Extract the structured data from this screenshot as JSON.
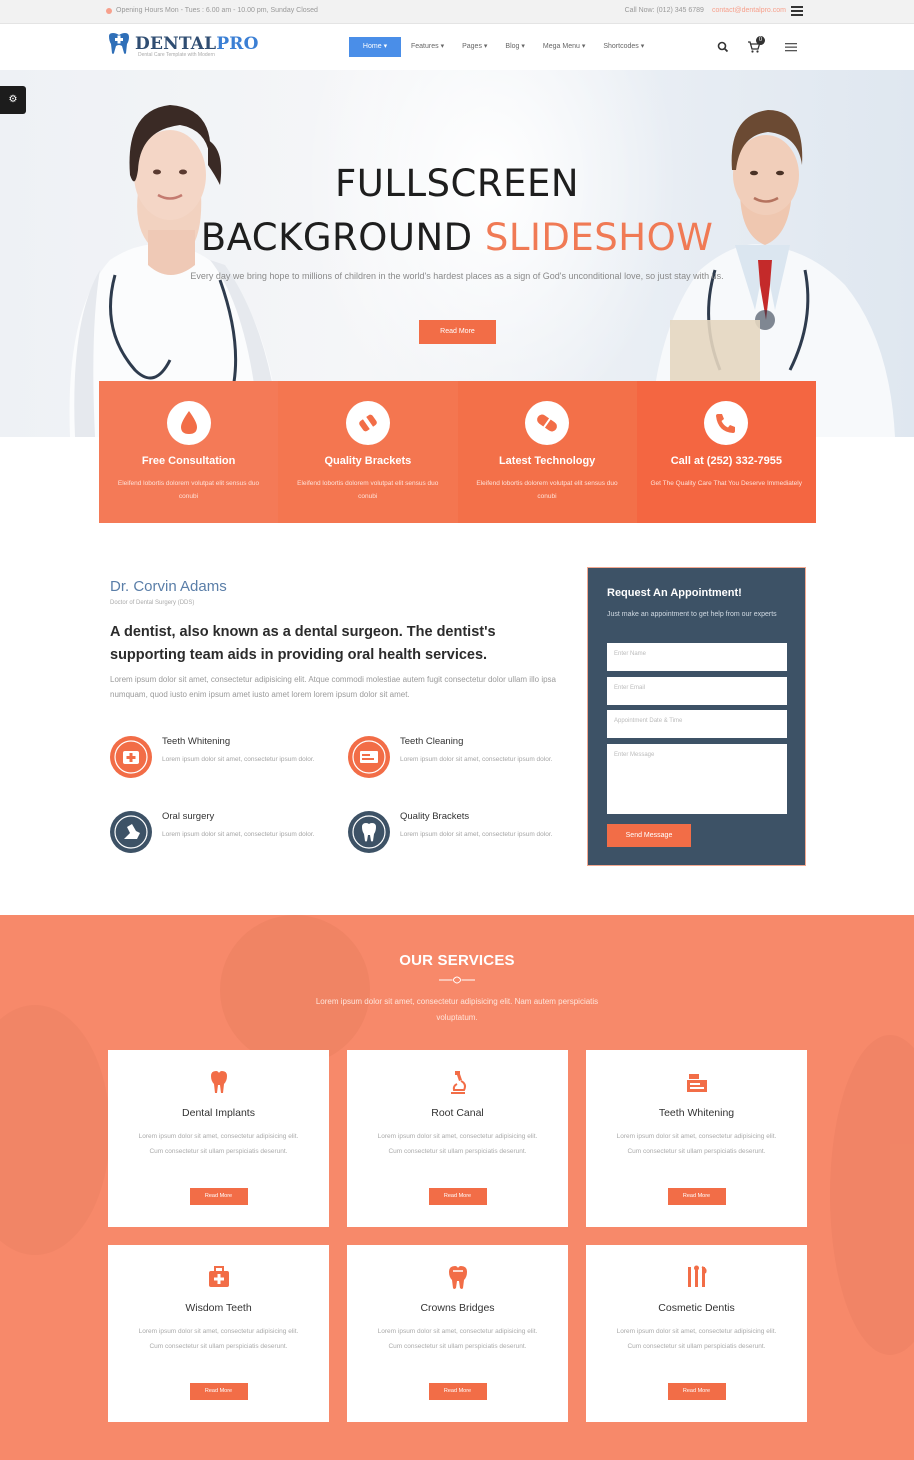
{
  "topbar": {
    "hours": "Opening Hours Mon - Tues : 6.00 am - 10.00 pm, Sunday Closed",
    "phone": "Call Now: (012) 345 6789",
    "email": "contact@dentalpro.com"
  },
  "header": {
    "logo_main": "DENTAL",
    "logo_accent": "PRO",
    "logo_tagline": "Dental Care Template with Modern",
    "nav": [
      "Home",
      "Features",
      "Pages",
      "Blog",
      "Mega Menu",
      "Shortcodes"
    ],
    "cart_count": "0"
  },
  "hero": {
    "title_line1": "FULLSCREEN",
    "title_line2": "BACKGROUND ",
    "title_accent": "SLIDESHOW",
    "text": "Every day we bring hope to millions of children in the world's hardest places as a sign of God's unconditional love, so just stay with us.",
    "button": "Read More"
  },
  "features": [
    {
      "title": "Free Consultation",
      "desc": "Eleifend lobortis dolorem volutpat elit sensus duo conubi",
      "color": "#f47a57"
    },
    {
      "title": "Quality Brackets",
      "desc": "Eleifend lobortis dolorem volutpat elit sensus duo conubi",
      "color": "#f47650"
    },
    {
      "title": "Latest Technology",
      "desc": "Eleifend lobortis dolorem volutpat elit sensus duo conubi",
      "color": "#f37049"
    },
    {
      "title": "Call at (252) 332-7955",
      "desc": "Get The Quality Care That You Deserve Immediately",
      "color": "#f46641"
    }
  ],
  "about": {
    "name": "Dr. Corvin Adams",
    "role": "Doctor of Dental Surgery (DDS)",
    "heading": "A dentist, also known as a dental surgeon. The dentist's supporting team aids in providing oral health services.",
    "text": "Lorem ipsum dolor sit amet, consectetur adipisicing elit. Atque commodi molestiae autem fugit consectetur dolor ullam illo ipsa numquam, quod iusto enim ipsum amet iusto amet lorem lorem ipsum dolor sit amet.",
    "services": [
      {
        "title": "Teeth Whitening",
        "desc": "Lorem ipsum dolor sit amet, consectetur ipsum dolor.",
        "color": "#f26d47"
      },
      {
        "title": "Teeth Cleaning",
        "desc": "Lorem ipsum dolor sit amet, consectetur ipsum dolor.",
        "color": "#f26d47"
      },
      {
        "title": "Oral surgery",
        "desc": "Lorem ipsum dolor sit amet, consectetur ipsum dolor.",
        "color": "#3d5266"
      },
      {
        "title": "Quality Brackets",
        "desc": "Lorem ipsum dolor sit amet, consectetur ipsum dolor.",
        "color": "#3d5266"
      }
    ]
  },
  "appointment": {
    "title": "Request An Appointment!",
    "subtitle": "Just make an appointment to get help from our experts",
    "name_placeholder": "Enter Name",
    "email_placeholder": "Enter Email",
    "date_placeholder": "Appointment Date & Time",
    "message_placeholder": "Enter Message",
    "button": "Send Message"
  },
  "services": {
    "title": "OUR SERVICES",
    "desc": "Lorem ipsum dolor sit amet, consectetur adipisicing elit. Nam autem perspiciatis voluptatum.",
    "cards": [
      {
        "title": "Dental Implants",
        "desc": "Lorem ipsum dolor sit amet, consectetur adipisicing elit. Cum consectetur sit ullam perspiciatis deserunt.",
        "button": "Read More"
      },
      {
        "title": "Root Canal",
        "desc": "Lorem ipsum dolor sit amet, consectetur adipisicing elit. Cum consectetur sit ullam perspiciatis deserunt.",
        "button": "Read More"
      },
      {
        "title": "Teeth Whitening",
        "desc": "Lorem ipsum dolor sit amet, consectetur adipisicing elit. Cum consectetur sit ullam perspiciatis deserunt.",
        "button": "Read More"
      },
      {
        "title": "Wisdom Teeth",
        "desc": "Lorem ipsum dolor sit amet, consectetur adipisicing elit. Cum consectetur sit ullam perspiciatis deserunt.",
        "button": "Read More"
      },
      {
        "title": "Crowns Bridges",
        "desc": "Lorem ipsum dolor sit amet, consectetur adipisicing elit. Cum consectetur sit ullam perspiciatis deserunt.",
        "button": "Read More"
      },
      {
        "title": "Cosmetic Dentis",
        "desc": "Lorem ipsum dolor sit amet, consectetur adipisicing elit. Cum consectetur sit ullam perspiciatis deserunt.",
        "button": "Read More"
      }
    ]
  }
}
